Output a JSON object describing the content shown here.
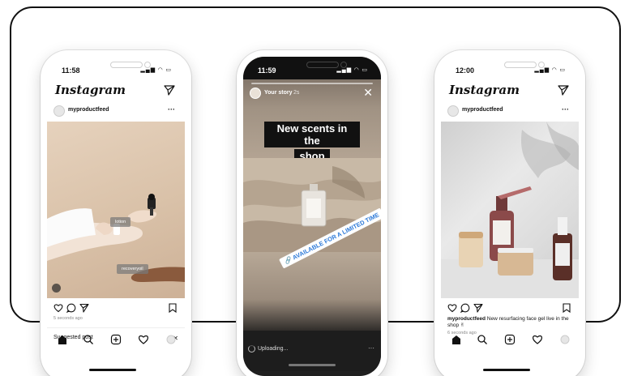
{
  "phones": [
    {
      "status_time": "11:58",
      "app_logo": "Instagram",
      "username": "myproductfeed",
      "more_icon_text": "···",
      "tags": [
        "lotion",
        "recoveryoil"
      ],
      "timestamp": "5 seconds ago",
      "suggested_label": "Suggested post",
      "suggested_close": "✕"
    },
    {
      "status_time": "11:59",
      "story_user": "Your story",
      "story_time": "2s",
      "close_icon_text": "✕",
      "headline_lines": [
        "New scents in the",
        "shop"
      ],
      "sticker_text": "🔗 AVAILABLE FOR A LIMITED TIME",
      "upload_text": "Uploading...",
      "upload_more": "···"
    },
    {
      "status_time": "12:00",
      "app_logo": "Instagram",
      "username": "myproductfeed",
      "more_icon_text": "···",
      "caption_user": "myproductfeed",
      "caption_text": "New resurfacing face gel live in the shop ✌",
      "timestamp": "6 seconds ago"
    }
  ],
  "icons": [
    "home-icon",
    "search-icon",
    "add-icon",
    "heart-icon",
    "profile-icon",
    "send-icon",
    "comment-icon",
    "bookmark-icon"
  ],
  "colors": {
    "story_sticker_text": "#2f7bd9",
    "headline_bg": "#111111",
    "upload_bar": "#1d1d1d"
  }
}
